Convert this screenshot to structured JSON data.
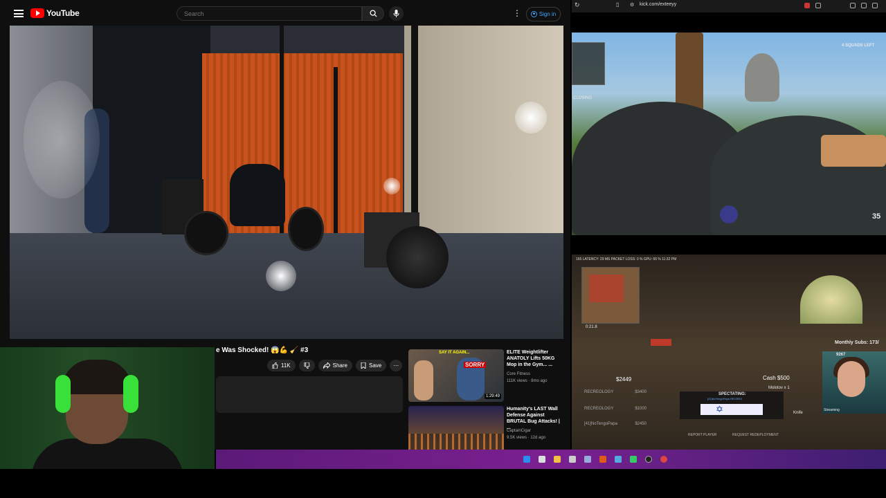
{
  "youtube": {
    "logo_text": "YouTube",
    "search_placeholder": "Search",
    "signin_label": "Sign in",
    "video_title": "e Was Shocked! 😱💪 🧹 #3",
    "likes_label": "11K",
    "share_label": "Share",
    "save_label": "Save",
    "related": [
      {
        "title": "ELITE Weightlifter ANATOLY Lifts 50KG Mop in the Gym... ...",
        "channel": "Core Fitness",
        "meta": "111K views · 8mo ago",
        "duration": "1:29:49",
        "thumb_text": "SORRY",
        "thumb_text2": "SAY IT AGAIN..."
      },
      {
        "title": "Humanity's LAST Wall Defense Against BRUTAL Bug Attacks! | ...",
        "channel": "CaptainCigar",
        "meta": "9.5K views · 12d ago",
        "duration": "",
        "thumb_text": "",
        "thumb_text2": ""
      }
    ]
  },
  "browser": {
    "url": "kick.com/exteeyy",
    "stream_stats": "165 LATENCY: 29 MS PACKET LOSS: 0 % GPU: 66 % 11:32 PM",
    "squads_left": "4 SQUADS LEFT",
    "hp_number": "35",
    "closing_label": "CLOSING",
    "timer": "0:21.8",
    "money_main": "$2449",
    "teammates": [
      {
        "name": "RECREOLOGY",
        "money": "$3400"
      },
      {
        "name": "RECREOLOGY",
        "money": "$1000"
      },
      {
        "name": "[41]NoTengoPapa",
        "money": "$2450"
      }
    ],
    "cash_label": "Cash $500",
    "item_label": "Molotov x 1",
    "knife_label": "Knife",
    "spectating_label": "SPECTATING:",
    "spectating_name": "[41]NoTengoPapa RECREO",
    "report_label": "REPORT PLAYER",
    "redeploy_label": "REQUEST REDEPLOYMENT",
    "monthly_subs": "Monthly Subs: 173/",
    "sub_count": "9267",
    "streaming_label": "Streaming"
  },
  "colors": {
    "youtube_red": "#ff0000",
    "taskbar_purple": "#7b2090",
    "link_blue": "#3ea6ff"
  }
}
